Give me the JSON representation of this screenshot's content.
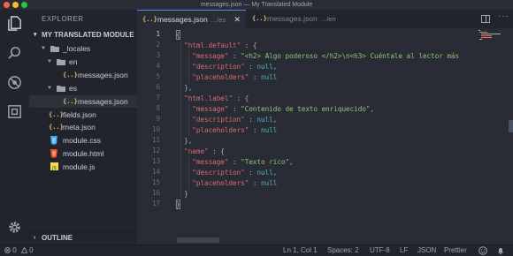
{
  "window": {
    "title": "messages.json — My Translated Module"
  },
  "sidebar": {
    "title": "EXPLORER",
    "section": "MY TRANSLATED MODULE",
    "tree": [
      {
        "label": "_locales",
        "kind": "folder"
      },
      {
        "label": "en",
        "kind": "folder"
      },
      {
        "label": "messages.json",
        "kind": "json"
      },
      {
        "label": "es",
        "kind": "folder"
      },
      {
        "label": "messages.json",
        "kind": "json"
      },
      {
        "label": "fields.json",
        "kind": "json"
      },
      {
        "label": "meta.json",
        "kind": "json"
      },
      {
        "label": "module.css",
        "kind": "css"
      },
      {
        "label": "module.html",
        "kind": "html"
      },
      {
        "label": "module.js",
        "kind": "js"
      }
    ],
    "outline": "OUTLINE"
  },
  "tabs": [
    {
      "icon": "{..}",
      "name": "messages.json",
      "path": "…/es",
      "close": "✕"
    },
    {
      "icon": "{..}",
      "name": "messages.json",
      "path": "…/en"
    }
  ],
  "editor": {
    "line_numbers": [
      "1",
      "2",
      "3",
      "4",
      "5",
      "6",
      "7",
      "8",
      "9",
      "10",
      "11",
      "12",
      "13",
      "14",
      "15",
      "16",
      "17"
    ],
    "lines": [
      [
        {
          "t": "{",
          "c": "p"
        }
      ],
      [
        {
          "t": "  ",
          "c": "p"
        },
        {
          "t": "\"html.default\"",
          "c": "k"
        },
        {
          "t": " : {",
          "c": "p"
        }
      ],
      [
        {
          "t": "    ",
          "c": "p"
        },
        {
          "t": "\"message\"",
          "c": "k"
        },
        {
          "t": " : ",
          "c": "p"
        },
        {
          "t": "\"<h2> Algo poderoso </h2>\\n<h3> Cuéntale al lector más",
          "c": "s"
        }
      ],
      [
        {
          "t": "    ",
          "c": "p"
        },
        {
          "t": "\"description\"",
          "c": "k"
        },
        {
          "t": " : ",
          "c": "p"
        },
        {
          "t": "null",
          "c": "n"
        },
        {
          "t": ",",
          "c": "p"
        }
      ],
      [
        {
          "t": "    ",
          "c": "p"
        },
        {
          "t": "\"placeholders\"",
          "c": "k"
        },
        {
          "t": " : ",
          "c": "p"
        },
        {
          "t": "null",
          "c": "n"
        }
      ],
      [
        {
          "t": "  },",
          "c": "p"
        }
      ],
      [
        {
          "t": "  ",
          "c": "p"
        },
        {
          "t": "\"html.label\"",
          "c": "k"
        },
        {
          "t": " : {",
          "c": "p"
        }
      ],
      [
        {
          "t": "    ",
          "c": "p"
        },
        {
          "t": "\"message\"",
          "c": "k"
        },
        {
          "t": " : ",
          "c": "p"
        },
        {
          "t": "\"Contenido de texto enriquecido\"",
          "c": "s"
        },
        {
          "t": ",",
          "c": "p"
        }
      ],
      [
        {
          "t": "    ",
          "c": "p"
        },
        {
          "t": "\"description\"",
          "c": "k"
        },
        {
          "t": " : ",
          "c": "p"
        },
        {
          "t": "null",
          "c": "n"
        },
        {
          "t": ",",
          "c": "p"
        }
      ],
      [
        {
          "t": "    ",
          "c": "p"
        },
        {
          "t": "\"placeholders\"",
          "c": "k"
        },
        {
          "t": " : ",
          "c": "p"
        },
        {
          "t": "null",
          "c": "n"
        }
      ],
      [
        {
          "t": "  },",
          "c": "p"
        }
      ],
      [
        {
          "t": "  ",
          "c": "p"
        },
        {
          "t": "\"name\"",
          "c": "k"
        },
        {
          "t": " : {",
          "c": "p"
        }
      ],
      [
        {
          "t": "    ",
          "c": "p"
        },
        {
          "t": "\"message\"",
          "c": "k"
        },
        {
          "t": " : ",
          "c": "p"
        },
        {
          "t": "\"Texto rico\"",
          "c": "s"
        },
        {
          "t": ",",
          "c": "p"
        }
      ],
      [
        {
          "t": "    ",
          "c": "p"
        },
        {
          "t": "\"description\"",
          "c": "k"
        },
        {
          "t": " : ",
          "c": "p"
        },
        {
          "t": "null",
          "c": "n"
        },
        {
          "t": ",",
          "c": "p"
        }
      ],
      [
        {
          "t": "    ",
          "c": "p"
        },
        {
          "t": "\"placeholders\"",
          "c": "k"
        },
        {
          "t": " : ",
          "c": "p"
        },
        {
          "t": "null",
          "c": "n"
        }
      ],
      [
        {
          "t": "  }",
          "c": "p"
        }
      ],
      [
        {
          "t": "}",
          "c": "p"
        }
      ]
    ]
  },
  "statusbar": {
    "errors": "0",
    "warnings": "0",
    "position": "Ln 1, Col 1",
    "spaces": "Spaces: 2",
    "encoding": "UTF-8",
    "eol": "LF",
    "language": "JSON",
    "formatter": "Prettier"
  },
  "colors": {
    "accent": "#528bff",
    "json_icon": "#e5c07b",
    "key": "#e06c75",
    "string": "#98c379",
    "null": "#56b6c2"
  }
}
